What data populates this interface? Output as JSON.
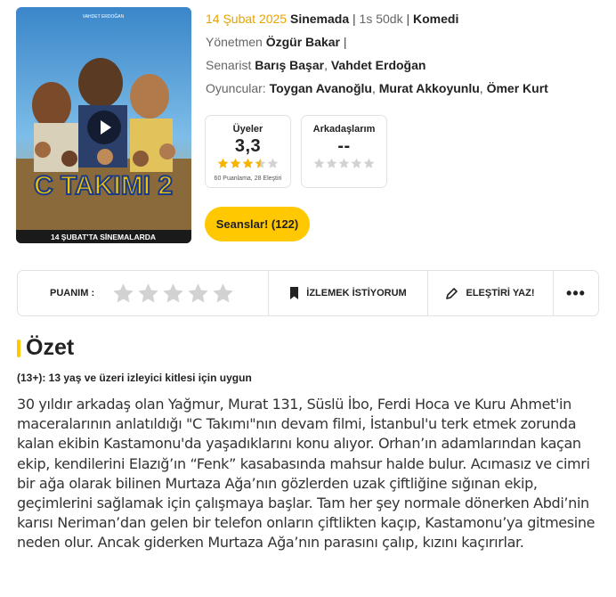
{
  "movie": {
    "poster_text": {
      "director_line": "VAHDET ERDOĞAN",
      "title_line": "C TAKIMI 2",
      "release_banner": "14 ŞUBAT'TA SİNEMALARDA"
    },
    "release_date": "14 Şubat 2025",
    "release_place": "Sinemada",
    "duration": "1s 50dk",
    "genre": "Komedi",
    "director_label": "Yönetmen",
    "director": "Özgür Bakar",
    "writer_label": "Senarist",
    "writers": [
      "Barış Başar",
      "Vahdet Erdoğan"
    ],
    "cast_label": "Oyuncular:",
    "cast": [
      "Toygan Avanoğlu",
      "Murat Akkoyunlu",
      "Ömer Kurt"
    ]
  },
  "scores": {
    "users": {
      "title": "Üyeler",
      "value": "3,3",
      "stars": 3.5,
      "subtitle": "60 Puanlama, 28 Eleştiri"
    },
    "friends": {
      "title": "Arkadaşlarım",
      "value": "--",
      "stars": 0
    }
  },
  "tickets_button": "Seanslar! (122)",
  "actions": {
    "rating_label": "PUANIM :",
    "watchlist_label": "İZLEMEK İSTİYORUM",
    "review_label": "ELEŞTİRİ YAZ!",
    "more_label": "•••"
  },
  "summary": {
    "heading": "Özet",
    "age_rating": "(13+): 13 yaş ve üzeri izleyici kitlesi için uygun",
    "description": "30 yıldır arkadaş olan Yağmur, Murat 131, Süslü İbo, Ferdi Hoca ve Kuru Ahmet'in maceralarının anlatıldığı \"C Takımı\"nın devam filmi, İstanbul'u terk etmek zorunda kalan ekibin Kastamonu'da yaşadıklarını konu alıyor. Orhan’ın adamlarından kaçan ekip, kendilerini  Elazığ’ın “Fenk” kasabasında mahsur halde bulur. Acımasız ve cimri bir ağa olarak bilinen Murtaza Ağa’nın gözlerden uzak çiftliğine sığınan ekip, geçimlerini sağlamak için çalışmaya başlar. Tam her şey normale dönerken Abdi’nin karısı Neriman’dan gelen bir telefon onların çiftlikten kaçıp,  Kastamonu’ya gitmesine neden olur. Ancak giderken  Murtaza Ağa’nın parasını çalıp, kızını kaçırırlar."
  },
  "colors": {
    "accent": "#ffc800",
    "date": "#e7a400",
    "star_on": "#f5b400",
    "star_off": "#d2d2d2"
  },
  "icons": [
    "play-icon",
    "star-icon",
    "bookmark-icon",
    "pencil-icon",
    "more-icon"
  ]
}
